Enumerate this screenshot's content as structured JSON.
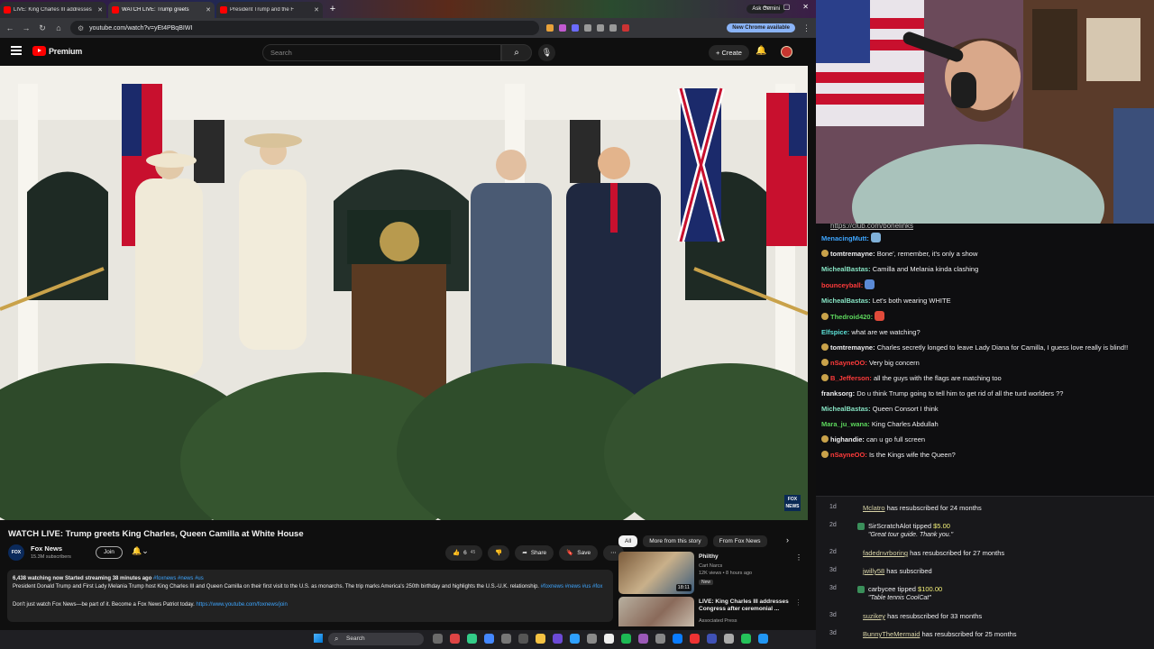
{
  "browser": {
    "tabs": [
      {
        "title": "LIVE: King Charles III addresses",
        "active": false
      },
      {
        "title": "WATCH LIVE: Trump greets",
        "active": true
      },
      {
        "title": "President Trump and the F",
        "active": false
      }
    ],
    "ask_gemini": "Ask Gemini",
    "url": "youtube.com/watch?v=yEt4PBqBIWI",
    "new_chrome": "New Chrome available"
  },
  "youtube": {
    "logo_text": "Premium",
    "search_placeholder": "Search",
    "create_label": "Create",
    "video": {
      "title": "WATCH LIVE: Trump greets King Charles, Queen Camilla at White House",
      "channel": "Fox News",
      "subscribers": "15.3M subscribers",
      "join_label": "Join",
      "likes": "6",
      "likes_sub": "45",
      "share_label": "Share",
      "save_label": "Save",
      "corner_bug": "FOX NEWS"
    },
    "description": {
      "meta": "6,438 watching now  Started streaming 38 minutes ago",
      "meta_tags": "#foxnews #news #us",
      "text": "President Donald Trump and First Lady Melania Trump host King Charles III and Queen Camilla on their first visit to the U.S. as monarchs. The trip marks America's 250th birthday and highlights the U.S.-U.K. relationship.",
      "text_tags": "#foxnews #news #us #fox",
      "patriot": "Don't just watch Fox News—be part of it. Become a Fox News Patriot today.",
      "patriot_link": "https://www.youtube.com/foxnews/join"
    },
    "chips": [
      "All",
      "More from this story",
      "From Fox News"
    ],
    "recommendations": [
      {
        "title": "Philthy",
        "channel": "Cart Narcs",
        "stats": "12K views • 8 hours ago",
        "badge": "New",
        "duration": "18:11"
      },
      {
        "title": "LIVE: King Charles III addresses Congress after ceremonial ...",
        "channel": "Associated Press",
        "stats": "",
        "badge": "",
        "duration": ""
      }
    ]
  },
  "taskbar": {
    "search": "Search"
  },
  "chat": {
    "link": "https://club.com/bonelinks",
    "messages": [
      {
        "user": "MenacingMutt:",
        "color": "#3ea6ff",
        "text": "",
        "badge": "",
        "emote": "#7fb0d8"
      },
      {
        "user": "tomtremayne:",
        "color": "#efeff1",
        "text": "Bone', remember, it's only a show",
        "badge": "#c9a24a",
        "emote": ""
      },
      {
        "user": "MichealBastas:",
        "color": "#86e3c3",
        "text": "Camilla and Melania kinda clashing",
        "badge": "",
        "emote": ""
      },
      {
        "user": "bounceyball:",
        "color": "#ff3b3b",
        "text": "",
        "badge": "",
        "emote": "#5a8ad6"
      },
      {
        "user": "MichealBastas:",
        "color": "#86e3c3",
        "text": "Let's both wearing WHITE",
        "badge": "",
        "emote": ""
      },
      {
        "user": "Thedroid420:",
        "color": "#5cd65c",
        "text": "",
        "badge": "#c9a24a",
        "emote": "#e04a3a"
      },
      {
        "user": "Elfspice:",
        "color": "#5ce0d6",
        "text": "what are we watching?",
        "badge": "",
        "emote": ""
      },
      {
        "user": "tomtremayne:",
        "color": "#efeff1",
        "text": "Charles secretly longed to leave Lady Diana for Camilla, I guess love really is blind!!",
        "badge": "#c9a24a",
        "emote": ""
      },
      {
        "user": "nSayneOO:",
        "color": "#ff3b3b",
        "text": "Very big concern",
        "badge": "#c9a24a",
        "emote": ""
      },
      {
        "user": "B_Jefferson:",
        "color": "#ff3b3b",
        "text": "all the guys with the flags are matching too",
        "badge": "#c9a24a",
        "emote": ""
      },
      {
        "user": "franksorg:",
        "color": "#efeff1",
        "text": "Do u think Trump going to tell him to get rid of all the turd worlders ??",
        "badge": "",
        "emote": ""
      },
      {
        "user": "MichealBastas:",
        "color": "#86e3c3",
        "text": "Queen Consort I think",
        "badge": "",
        "emote": ""
      },
      {
        "user": "Mara_ju_wana:",
        "color": "#5cd65c",
        "text": "King Charles Abdullah",
        "badge": "",
        "emote": ""
      },
      {
        "user": "highandie:",
        "color": "#efeff1",
        "text": "can u go full screen",
        "badge": "#c9a24a",
        "emote": ""
      },
      {
        "user": "nSayneOO:",
        "color": "#ff3b3b",
        "text": "Is the Kings wife the Queen?",
        "badge": "#c9a24a",
        "emote": ""
      }
    ]
  },
  "events": [
    {
      "age": "1d",
      "user": "Mclatro",
      "text": " has resubscribed for 24 months",
      "amount": "",
      "note": ""
    },
    {
      "age": "2d",
      "user": "SirScratchAlot",
      "text": " tipped ",
      "amount": "$5.00",
      "note": "\"Great tour guide. Thank you.\""
    },
    {
      "age": "2d",
      "user": "fadednvrboring",
      "text": " has resubscribed for 27 months",
      "amount": "",
      "note": ""
    },
    {
      "age": "3d",
      "user": "jwilly58",
      "text": " has subscribed",
      "amount": "",
      "note": ""
    },
    {
      "age": "3d",
      "user": "carbycee",
      "text": " tipped ",
      "amount": "$100.00",
      "note": "\"Table tennis CoolCat\""
    },
    {
      "age": "3d",
      "user": "suzikey",
      "text": " has resubscribed for 33 months",
      "amount": "",
      "note": ""
    },
    {
      "age": "3d",
      "user": "BunnyTheMermaid",
      "text": " has resubscribed for 25 months",
      "amount": "",
      "note": ""
    }
  ]
}
